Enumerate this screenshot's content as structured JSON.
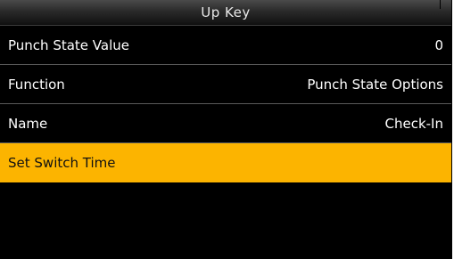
{
  "header": {
    "title": "Up Key"
  },
  "menu": {
    "items": [
      {
        "label": "Punch State Value",
        "value": "0"
      },
      {
        "label": "Function",
        "value": "Punch State Options"
      },
      {
        "label": "Name",
        "value": "Check-In"
      },
      {
        "label": "Set Switch Time",
        "value": ""
      }
    ],
    "selected_index": 3
  },
  "colors": {
    "highlight": "#fcb400",
    "background": "#000000",
    "text": "#ffffff"
  }
}
